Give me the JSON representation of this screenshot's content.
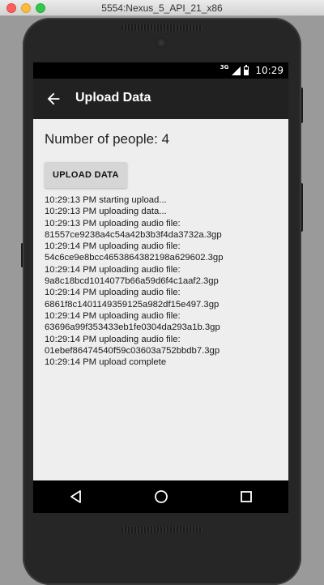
{
  "window": {
    "title": "5554:Nexus_5_API_21_x86"
  },
  "statusbar": {
    "network": "3G",
    "time": "10:29"
  },
  "appbar": {
    "title": "Upload Data"
  },
  "content": {
    "people_count": "Number of people: 4",
    "upload_button_label": "UPLOAD DATA",
    "log": [
      "10:29:13 PM starting upload...",
      "10:29:13 PM uploading data...",
      "10:29:13 PM uploading audio file:",
      "81557ce9238a4c54a42b3b3f4da3732a.3gp",
      "10:29:14 PM uploading audio file:",
      "54c6ce9e8bcc4653864382198a629602.3gp",
      "10:29:14 PM uploading audio file:",
      "9a8c18bcd1014077b66a59d6f4c1aaf2.3gp",
      "10:29:14 PM uploading audio file:",
      "6861f8c1401149359125a982df15e497.3gp",
      "10:29:14 PM uploading audio file:",
      "63696a99f353433eb1fe0304da293a1b.3gp",
      "10:29:14 PM uploading audio file:",
      "01ebef86474540f59c03603a752bbdb7.3gp",
      "10:29:14 PM upload complete"
    ]
  },
  "icons": {
    "back": "arrow-back-icon",
    "nav_back": "triangle-back-icon",
    "nav_home": "circle-home-icon",
    "nav_recents": "square-recents-icon"
  }
}
